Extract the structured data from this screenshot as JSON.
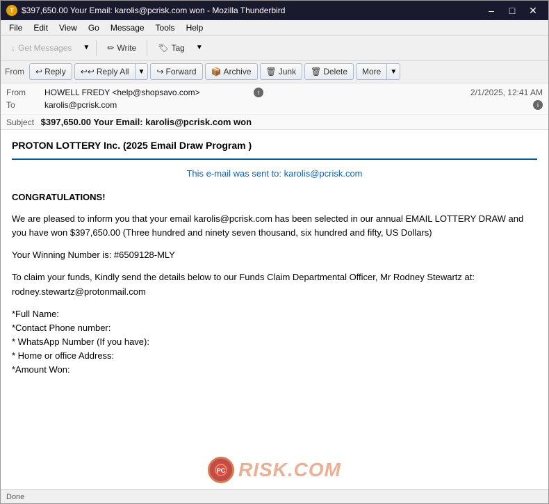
{
  "window": {
    "title": "$397,650.00 Your Email: karolis@pcrisk.com won - Mozilla Thunderbird",
    "icon_label": "T"
  },
  "menu": {
    "items": [
      "File",
      "Edit",
      "View",
      "Go",
      "Message",
      "Tools",
      "Help"
    ]
  },
  "toolbar": {
    "get_messages_label": "Get Messages",
    "write_label": "Write",
    "tag_label": "Tag"
  },
  "action_bar": {
    "from_label": "From",
    "reply_label": "Reply",
    "reply_all_label": "Reply All",
    "forward_label": "Forward",
    "archive_label": "Archive",
    "junk_label": "Junk",
    "delete_label": "Delete",
    "more_label": "More"
  },
  "email": {
    "from_label": "From",
    "from_value": "HOWELL FREDY <help@shopsavo.com>",
    "to_label": "To",
    "to_value": "karolis@pcrisk.com",
    "date": "2/1/2025, 12:41 AM",
    "subject_label": "Subject",
    "subject_value": "$397,650.00 Your Email: karolis@pcrisk.com won"
  },
  "body": {
    "letterhead": "PROTON LOTTERY Inc. (2025 Email Draw Program )",
    "sent_to_line": "This e-mail was sent to: karolis@pcrisk.com",
    "congratulations": "CONGRATULATIONS!",
    "paragraph1": "We are pleased to inform you that your email karolis@pcrisk.com has been selected in our annual EMAIL LOTTERY DRAW and you have won $397,650.00 (Three hundred and ninety seven thousand, six hundred and fifty, US Dollars)",
    "winning_number_label": "Your Winning Number is: #6509128-MLY",
    "paragraph2": "To claim your funds, Kindly send the details below to our Funds Claim Departmental Officer, Mr Rodney Stewartz at: rodney.stewartz@protonmail.com",
    "fields": [
      "*Full Name:",
      "*Contact Phone number:",
      "* WhatsApp Number (If you have):",
      "* Home or office Address:",
      "*Amount Won:"
    ]
  },
  "status": {
    "text": "Done"
  },
  "watermark": {
    "text": "RISK.COM"
  }
}
